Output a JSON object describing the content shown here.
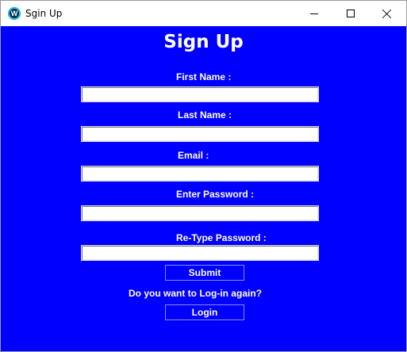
{
  "window": {
    "title": "Sgin Up",
    "icon_letter": "W"
  },
  "form": {
    "heading": "Sign Up",
    "first_name_label": "First Name :",
    "first_name_value": "",
    "last_name_label": "Last Name :",
    "last_name_value": "",
    "email_label": "Email :",
    "email_value": "",
    "password_label": "Enter Password :",
    "password_value": "",
    "retype_label": "Re-Type Password :",
    "retype_value": "",
    "submit_label": "Submit",
    "login_prompt": "Do you want to Log-in again?",
    "login_label": "Login"
  },
  "colors": {
    "background": "#0000ff",
    "text": "#ffffff"
  },
  "icons": [
    "app-icon",
    "minimize-icon",
    "maximize-icon",
    "close-icon"
  ]
}
